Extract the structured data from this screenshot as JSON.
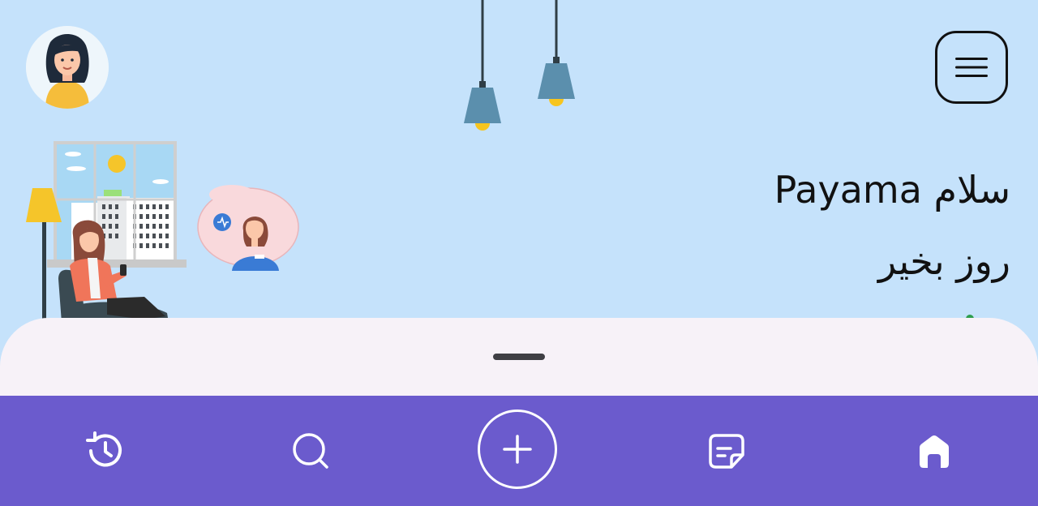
{
  "header": {
    "greeting": "سلام Payama",
    "sub_greeting": "روز بخیر"
  },
  "icons": {
    "avatar": "user-avatar",
    "menu": "hamburger-menu-icon",
    "history": "history-icon",
    "search": "search-icon",
    "add": "plus-icon",
    "notes": "note-icon",
    "home": "home-icon"
  },
  "colors": {
    "background": "#c5e2fb",
    "sheet": "#f7f2f8",
    "nav": "#6b5bcd",
    "lamp": "#5b8fad",
    "bulb": "#f7c51e"
  }
}
